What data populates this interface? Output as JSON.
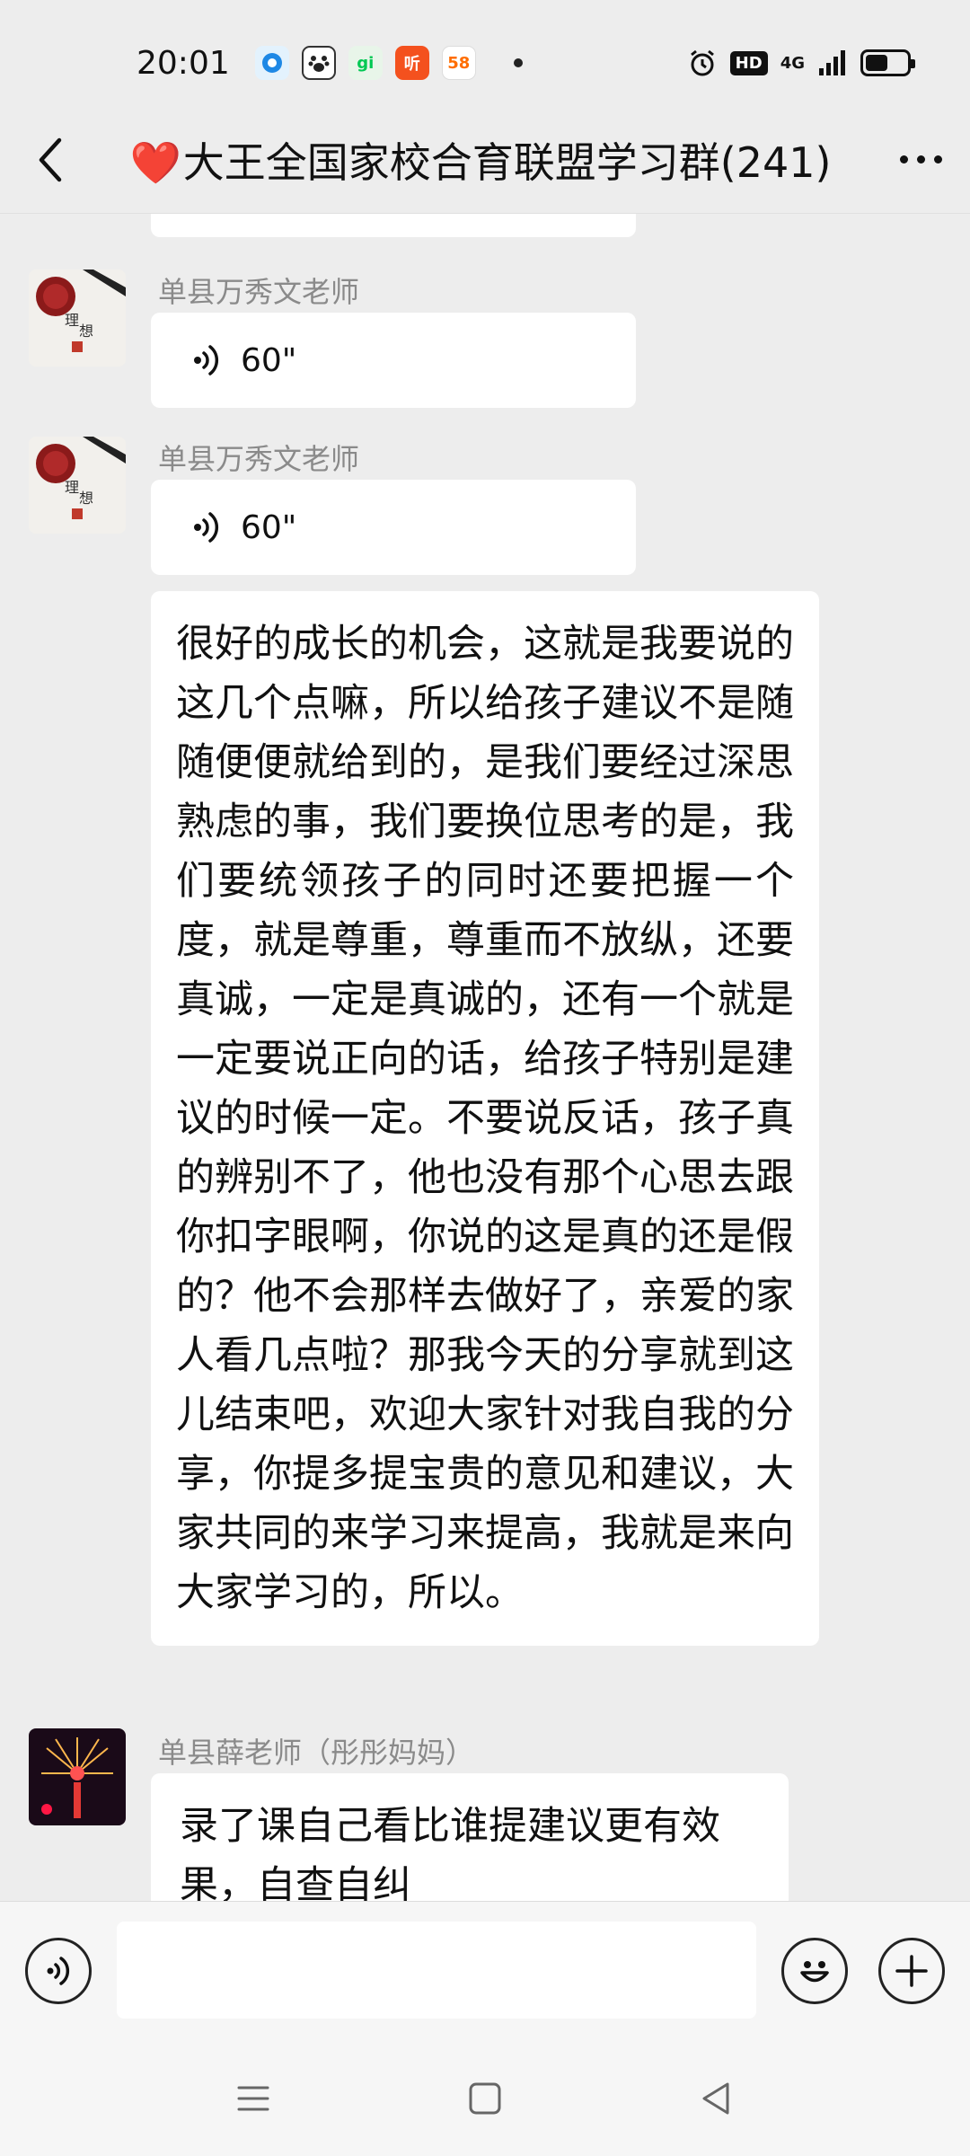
{
  "status_bar": {
    "time": "20:01",
    "notification_icons": [
      {
        "name": "browser-app-icon",
        "color": "#1e88e5",
        "glyph": "●"
      },
      {
        "name": "baidu-app-icon",
        "color": "#3b3b3b",
        "glyph": "🐾"
      },
      {
        "name": "iqiyi-app-icon",
        "color": "#00c853",
        "glyph": "gi"
      },
      {
        "name": "ting-app-icon",
        "color": "#f4511e",
        "glyph": "听"
      },
      {
        "name": "58-app-icon",
        "color": "#ff6d00",
        "glyph": "58"
      }
    ],
    "hd_label": "HD",
    "network_label": "4G",
    "battery_level": 0.55
  },
  "header": {
    "title_emoji": "❤️",
    "title": "大王全国家校合育联盟学习群(241)"
  },
  "messages": [
    {
      "sender": "单县万秀文老师",
      "type": "voice",
      "duration": "60\""
    },
    {
      "sender": "单县万秀文老师",
      "type": "voice",
      "duration": "60\""
    },
    {
      "type": "text",
      "text": "很好的成长的机会，这就是我要说的这几个点嘛，所以给孩子建议不是随随便便就给到的，是我们要经过深思熟虑的事，我们要换位思考的是，我们要统领孩子的同时还要把握一个度，就是尊重，尊重而不放纵，还要真诚，一定是真诚的，还有一个就是一定要说正向的话，给孩子特别是建议的时候一定。不要说反话，孩子真的辨别不了，他也没有那个心思去跟你扣字眼啊，你说的这是真的还是假的？他不会那样去做好了，亲爱的家人看几点啦？那我今天的分享就到这儿结束吧，欢迎大家针对我自我的分享，你提多提宝贵的意见和建议，大家共同的来学习来提高，我就是来向大家学习的，所以。"
    },
    {
      "sender": "单县薛老师（彤彤妈妈）",
      "type": "text",
      "text": "录了课自己看比谁提建议更有效果，自查自纠"
    }
  ],
  "input": {
    "placeholder": ""
  },
  "colors": {
    "background": "#ededed",
    "bubble": "#ffffff",
    "sender_name": "#8a8a8a",
    "heart": "#f0506e"
  }
}
